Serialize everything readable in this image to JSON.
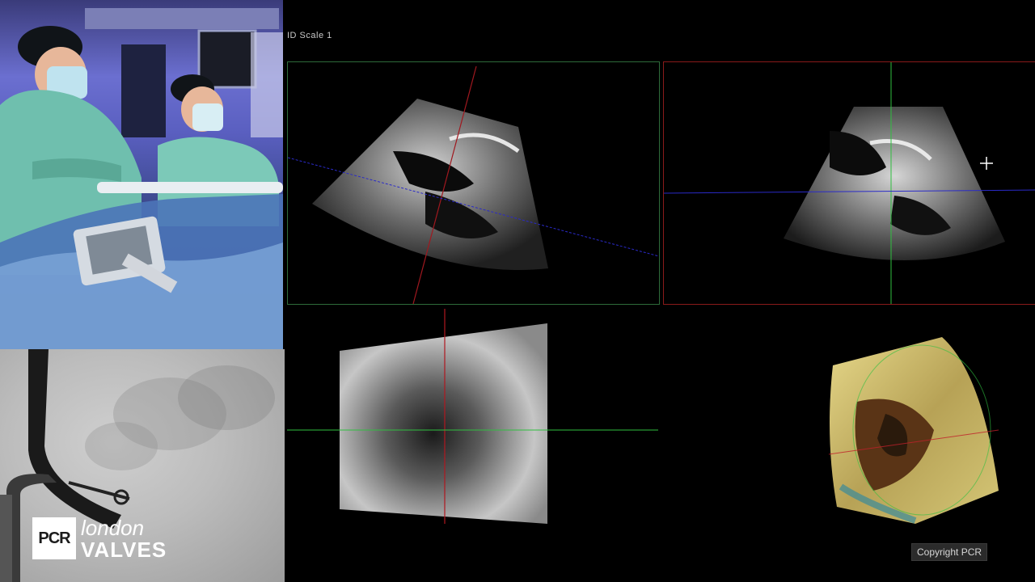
{
  "header": {
    "top_label": "ID Scale 1"
  },
  "logo": {
    "badge": "PCR",
    "line1": "london",
    "line2": "VALVES"
  },
  "footer": {
    "copyright": "Copyright PCR"
  },
  "colors": {
    "green_guide": "#2fbf3f",
    "red_guide": "#c0202a",
    "blue_guide": "#2a2ac8",
    "scrubs": "#6fbfae",
    "render_yellow": "#d6c46a"
  },
  "icons": {
    "cursor": "crosshair-cursor-icon"
  }
}
